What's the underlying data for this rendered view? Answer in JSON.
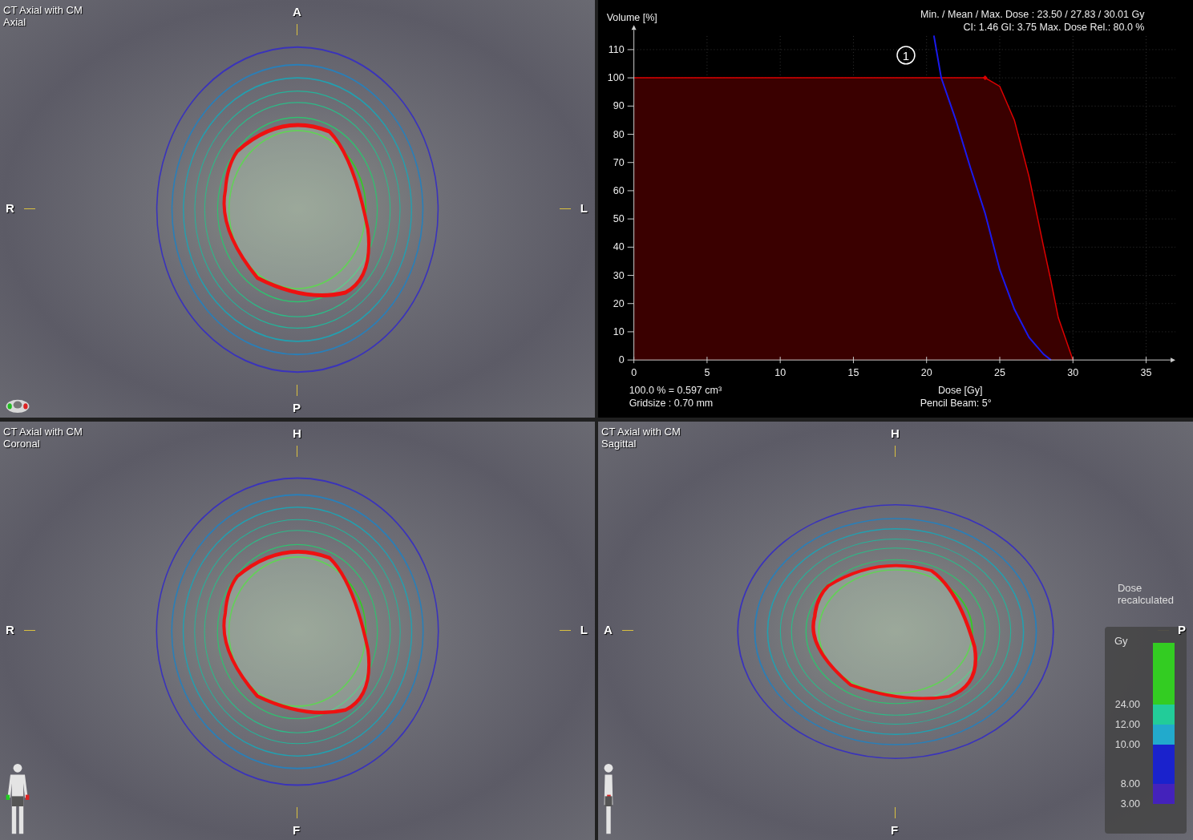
{
  "views": [
    {
      "title": "CT Axial with CM",
      "plane": "Axial",
      "orientation": {
        "top": "A",
        "bottom": "P",
        "left": "R",
        "right": "L"
      },
      "kind": "axial"
    },
    {
      "title": "CT Axial with CM",
      "plane": "Coronal",
      "orientation": {
        "top": "H",
        "bottom": "F",
        "left": "R",
        "right": "L"
      },
      "kind": "coronal"
    },
    {
      "title": "CT Axial with CM",
      "plane": "Sagittal",
      "orientation": {
        "top": "H",
        "bottom": "F",
        "left": "A",
        "right": "P"
      },
      "kind": "sagittal",
      "note": "Dose\nrecalculated",
      "legend": {
        "unit": "Gy",
        "levels": [
          {
            "value": "24.00",
            "color": "#33cc22"
          },
          {
            "value": "12.00",
            "color": "#22cc99"
          },
          {
            "value": "10.00",
            "color": "#22aacc"
          },
          {
            "value": "8.00",
            "color": "#1a22cc"
          },
          {
            "value": "3.00",
            "color": "#4422bb"
          }
        ]
      }
    }
  ],
  "dvh": {
    "stats": [
      "Min. / Mean / Max. Dose : 23.50 / 27.83 / 30.01 Gy",
      "CI: 1.46  GI: 3.75  Max. Dose Rel.: 80.0 %"
    ],
    "marker": "1",
    "volume_note": "100.0 % = 0.597 cm³",
    "gridsize": "Gridsize : 0.70 mm",
    "algorithm": "Pencil Beam: 5°",
    "chart_data": {
      "type": "area",
      "xlabel": "Dose [Gy]",
      "ylabel": "Volume [%]",
      "x": [
        0,
        20.5,
        21,
        22,
        23,
        24,
        25,
        26,
        27,
        28,
        28.5,
        29,
        30
      ],
      "series": [
        {
          "type": "area",
          "color": "#dd0000",
          "values": [
            100,
            100,
            100,
            100,
            100,
            100,
            97,
            85,
            65,
            40,
            28,
            15,
            0
          ]
        },
        {
          "type": "line",
          "color": "#1a1aee",
          "values": [
            null,
            115,
            100,
            85,
            68,
            52,
            32,
            18,
            8,
            2,
            0,
            null,
            null
          ]
        }
      ],
      "grid": true,
      "xlim": [
        0,
        37
      ],
      "ylim": [
        0,
        115
      ],
      "xticks": [
        0,
        5,
        10,
        15,
        20,
        25,
        30,
        35
      ],
      "yticks": [
        0,
        10,
        20,
        30,
        40,
        50,
        60,
        70,
        80,
        90,
        100,
        110
      ]
    }
  }
}
